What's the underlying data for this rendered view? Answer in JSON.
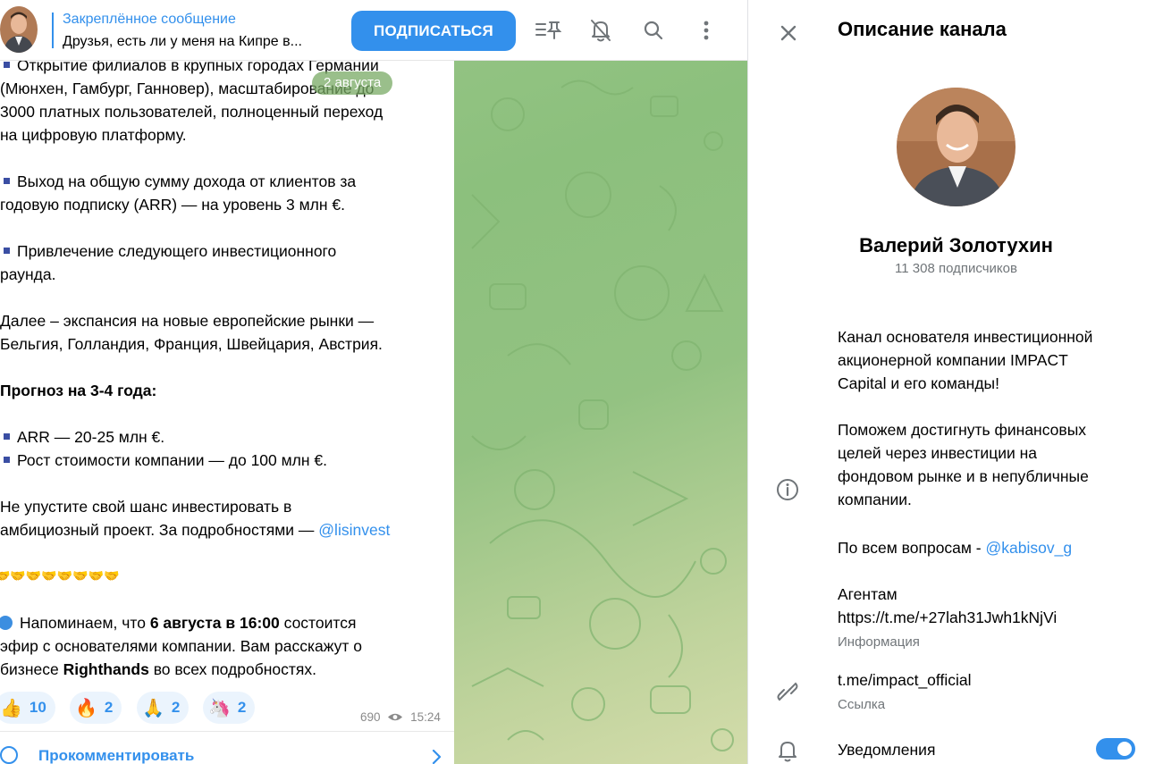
{
  "header": {
    "pinned_title": "Закреплённое сообщение",
    "pinned_text": "Друзья, есть ли у меня на Кипре в...",
    "subscribe_label": "ПОДПИСАТЬСЯ"
  },
  "message": {
    "date_pill": "2 августа",
    "lines": [
      "Открытие филиалов в крупных городах Германии",
      "(Мюнхен, Гамбург, Ганновер), масштабирование до",
      "3000 платных пользователей, полноценный переход",
      "на цифровую платформу.",
      "Выход на общую сумму дохода от клиентов за",
      "годовую подписку (ARR) — на уровень 3 млн €.",
      "Привлечение следующего инвестиционного",
      "раунда.",
      "Далее – экспансия на новые европейские рынки —",
      "Бельгия, Голландия, Франция, Швейцария, Австрия.",
      "Прогноз на 3-4 года:",
      "ARR — 20-25 млн €.",
      "Рост стоимости компании — до 100 млн €.",
      "Не упустите свой шанс инвестировать в",
      "амбициозный проект. За подробностями — ",
      "@lisinvest",
      "🤝🤝🤝🤝🤝🤝🤝🤝",
      "Напоминаем, что ",
      "6 августа в 16:00",
      " состоится",
      "эфир с основателями компании. Вам расскажут о",
      "бизнесе ",
      "Righthands",
      " во всех подробностях."
    ],
    "reactions": [
      {
        "emoji": "👍",
        "count": "10"
      },
      {
        "emoji": "🔥",
        "count": "2"
      },
      {
        "emoji": "🙏",
        "count": "2"
      },
      {
        "emoji": "🦄",
        "count": "2"
      }
    ],
    "views": "690",
    "time": "15:24",
    "comment_label": "Прокомментировать"
  },
  "panel": {
    "title": "Описание канала",
    "channel_name": "Валерий Золотухин",
    "subscribers": "11 308 подписчиков",
    "description_lines": [
      "Канал основателя инвестиционной",
      "акционерной компании IMPACT",
      "Capital и его команды!",
      "Поможем достигнуть финансовых",
      "целей через инвестиции на",
      "фондовом рынке и в непубличные",
      "компании.",
      "По всем вопросам - ",
      "@kabisov_g",
      "Агентам",
      "https://t.me/+27lah31Jwh1kNjVi"
    ],
    "info_caption": "Информация",
    "link_value": "t.me/impact_official",
    "link_caption": "Ссылка",
    "notifications_label": "Уведомления",
    "notifications_on": true
  },
  "colors": {
    "accent": "#3390ec",
    "chat_background": "#8cc07d"
  },
  "icons": [
    "pinned-list-icon",
    "mute-icon",
    "search-icon",
    "more-icon",
    "close-icon",
    "info-icon",
    "link-icon",
    "bell-icon",
    "eye-icon",
    "chevron-right-icon",
    "comment-icon"
  ]
}
